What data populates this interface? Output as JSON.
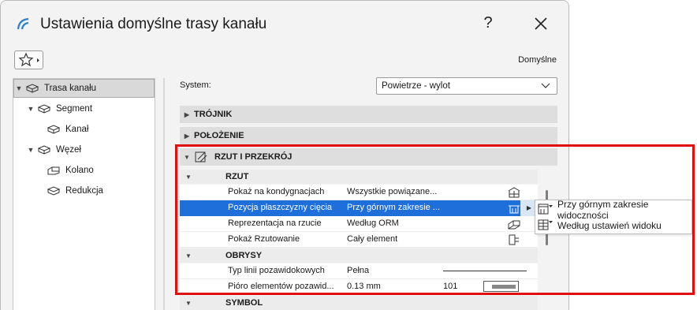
{
  "window": {
    "title": "Ustawienia domyślne trasy kanału",
    "help_label": "?",
    "default_label": "Domyślne",
    "accent_color": "#1e6fd9"
  },
  "tree": {
    "items": [
      {
        "label": "Trasa kanału",
        "icon": "route-icon",
        "expanded": true,
        "selected": true
      },
      {
        "label": "Segment",
        "icon": "segment-icon",
        "expanded": true
      },
      {
        "label": "Kanał",
        "icon": "duct-icon"
      },
      {
        "label": "Węzeł",
        "icon": "node-icon",
        "expanded": true
      },
      {
        "label": "Kolano",
        "icon": "elbow-icon"
      },
      {
        "label": "Redukcja",
        "icon": "reducer-icon"
      }
    ]
  },
  "system": {
    "label": "System:",
    "value": "Powietrze - wylot"
  },
  "sections": {
    "trojnik": "TRÓJNIK",
    "polozenie": "POŁOŻENIE",
    "rzut_przekroj": "RZUT I PRZEKRÓJ"
  },
  "groups": {
    "rzut": "RZUT",
    "obrysy": "OBRYSY",
    "symbol": "SYMBOL"
  },
  "rows": [
    {
      "name": "Pokaż na kondygnacjach",
      "value": "Wszystkie powiązane..."
    },
    {
      "name": "Pozycja płaszczyzny cięcia",
      "value": "Przy górnym zakresie ..."
    },
    {
      "name": "Reprezentacja na rzucie",
      "value": "Według ORM"
    },
    {
      "name": "Pokaż Rzutowanie",
      "value": "Cały element"
    },
    {
      "name": "Typ linii pozawidokowych",
      "value": "Pełna"
    },
    {
      "name": "Pióro elementów pozawid...",
      "value": "0.13 mm",
      "number": "101"
    }
  ],
  "popup": {
    "items": [
      {
        "label": "Przy górnym zakresie widoczności"
      },
      {
        "label": "Według ustawień widoku"
      }
    ]
  },
  "highlight_color": "#e01010"
}
